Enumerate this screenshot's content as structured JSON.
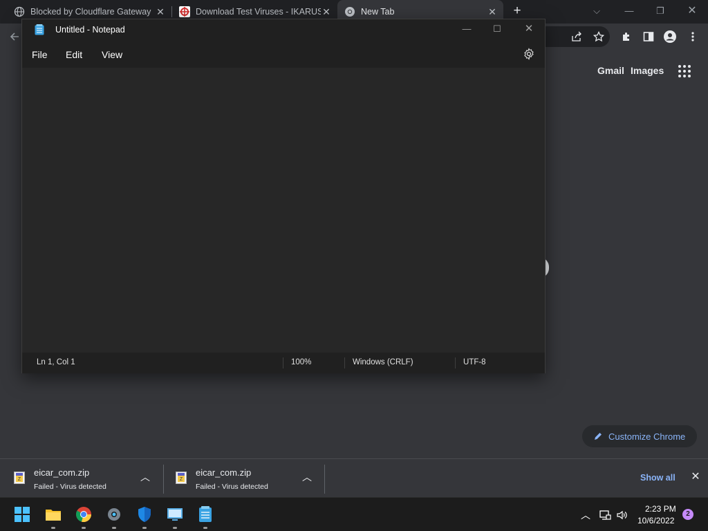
{
  "browser": {
    "tabs": [
      {
        "title": "Blocked by Cloudflare Gateway",
        "icon": "globe-icon",
        "active": false
      },
      {
        "title": "Download Test Viruses - IKARUS",
        "icon": "ikarus-icon",
        "active": false
      },
      {
        "title": "New Tab",
        "icon": "chrome-icon",
        "active": true
      }
    ],
    "new_tab_symbol": "+",
    "toolbar_icons": [
      "back-icon",
      "share-icon",
      "bookmark-star-icon",
      "extensions-icon",
      "side-panel-icon",
      "profile-icon",
      "menu-icon"
    ]
  },
  "ntp": {
    "gmail_link": "Gmail",
    "images_link": "Images",
    "customize_label": "Customize Chrome"
  },
  "notepad": {
    "title": "Untitled - Notepad",
    "menu": {
      "file": "File",
      "edit": "Edit",
      "view": "View"
    },
    "content": "",
    "status": {
      "position": "Ln 1, Col 1",
      "zoom": "100%",
      "line_ending": "Windows (CRLF)",
      "encoding": "UTF-8"
    }
  },
  "downloads": {
    "items": [
      {
        "name": "eicar_com.zip",
        "status": "Failed - Virus detected"
      },
      {
        "name": "eicar_com.zip",
        "status": "Failed - Virus detected"
      }
    ],
    "show_all": "Show all"
  },
  "taskbar": {
    "apps": [
      "start-icon",
      "file-explorer-icon",
      "chrome-icon",
      "settings-icon",
      "windows-security-icon",
      "remote-desktop-icon",
      "notepad-icon"
    ],
    "time": "2:23 PM",
    "date": "10/6/2022",
    "notification_count": "2"
  },
  "colors": {
    "chrome_frame": "#202124",
    "chrome_toolbar": "#35363a",
    "link_blue": "#8ab4f8",
    "notepad_bg": "#272727",
    "taskbar_bg": "#1c1c1c"
  }
}
